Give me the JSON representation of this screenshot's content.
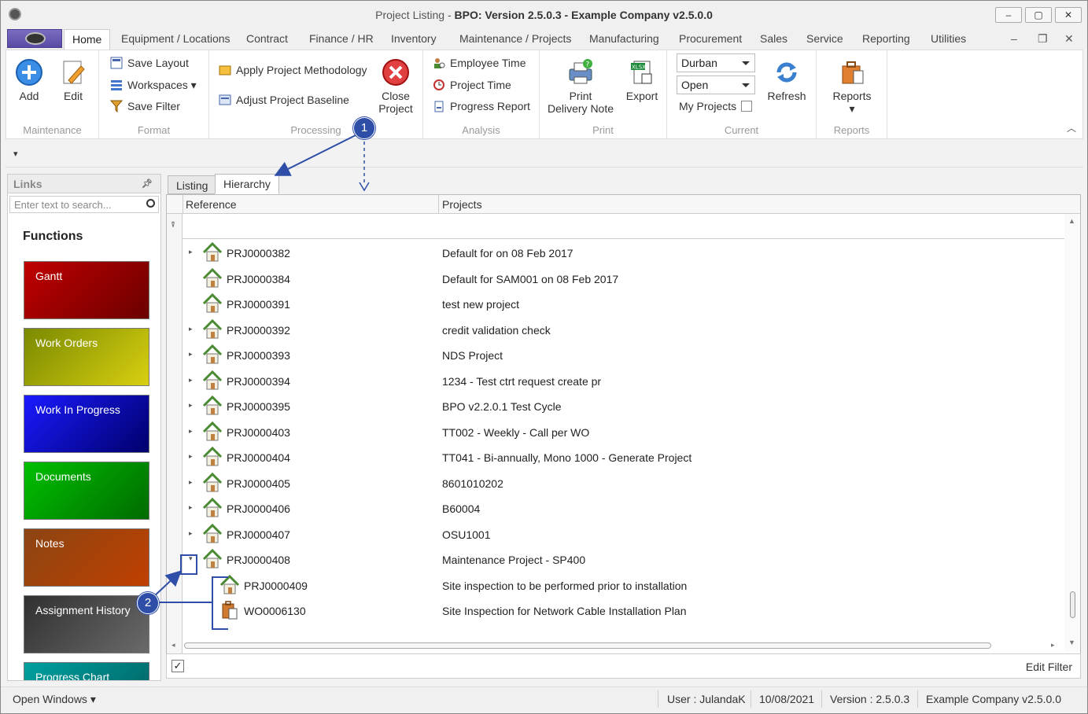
{
  "window": {
    "title_prefix": "Project Listing - ",
    "title_bold": "BPO: Version 2.5.0.3 - Example Company v2.5.0.0",
    "min_label": "–",
    "max_label": "▢",
    "close_label": "✕"
  },
  "menu": {
    "tabs": [
      "Home",
      "Equipment / Locations",
      "Contract",
      "Finance / HR",
      "Inventory",
      "Maintenance / Projects",
      "Manufacturing",
      "Procurement",
      "Sales",
      "Service",
      "Reporting",
      "Utilities"
    ],
    "mdi_min": "–",
    "mdi_restore": "❐",
    "mdi_close": "✕"
  },
  "ribbon": {
    "maintenance": {
      "label": "Maintenance",
      "add": "Add",
      "edit": "Edit"
    },
    "format": {
      "label": "Format",
      "save_layout": "Save Layout",
      "workspaces": "Workspaces",
      "save_filter": "Save Filter"
    },
    "processing": {
      "label": "Processing",
      "apply_methodology": "Apply Project Methodology",
      "adjust_baseline": "Adjust Project Baseline",
      "close_project_1": "Close",
      "close_project_2": "Project"
    },
    "analysis": {
      "label": "Analysis",
      "employee_time": "Employee Time",
      "project_time": "Project Time",
      "progress_report": "Progress Report"
    },
    "print": {
      "label": "Print",
      "print_dn_1": "Print",
      "print_dn_2": "Delivery Note",
      "export": "Export"
    },
    "current": {
      "label": "Current",
      "site": "Durban",
      "status": "Open",
      "my_projects": "My Projects",
      "refresh": "Refresh"
    },
    "reports": {
      "label": "Reports",
      "reports": "Reports"
    }
  },
  "links": {
    "title": "Links",
    "search_placeholder": "Enter text to search...",
    "functions_title": "Functions",
    "tiles": [
      {
        "label": "Gantt",
        "color_a": "#c00000",
        "color_b": "#6b0000"
      },
      {
        "label": "Work Orders",
        "color_a": "#7a8a00",
        "color_b": "#d8cf10"
      },
      {
        "label": "Work In Progress",
        "color_a": "#1a1aff",
        "color_b": "#00006b"
      },
      {
        "label": "Documents",
        "color_a": "#00c000",
        "color_b": "#006b00"
      },
      {
        "label": "Notes",
        "color_a": "#8b4513",
        "color_b": "#c04000"
      },
      {
        "label": "Assignment History",
        "color_a": "#303030",
        "color_b": "#6a6a6a"
      },
      {
        "label": "Progress Chart",
        "color_a": "#00a0a0",
        "color_b": "#006060"
      }
    ]
  },
  "tabs": {
    "listing": "Listing",
    "hierarchy": "Hierarchy"
  },
  "grid": {
    "columns": {
      "reference": "Reference",
      "projects": "Projects"
    },
    "rows": [
      {
        "ref": "PRJ0000382",
        "proj": "Default for  on 08 Feb 2017",
        "expander": "▸",
        "level": 0
      },
      {
        "ref": "PRJ0000384",
        "proj": "Default for SAM001 on 08 Feb 2017",
        "expander": "",
        "level": 0
      },
      {
        "ref": "PRJ0000391",
        "proj": "test new project",
        "expander": "",
        "level": 0
      },
      {
        "ref": "PRJ0000392",
        "proj": "credit validation check",
        "expander": "▸",
        "level": 0
      },
      {
        "ref": "PRJ0000393",
        "proj": "NDS Project",
        "expander": "▸",
        "level": 0
      },
      {
        "ref": "PRJ0000394",
        "proj": "1234 - Test ctrt request create pr",
        "expander": "▸",
        "level": 0
      },
      {
        "ref": "PRJ0000395",
        "proj": "BPO v2.2.0.1 Test Cycle",
        "expander": "▸",
        "level": 0
      },
      {
        "ref": "PRJ0000403",
        "proj": "TT002 - Weekly - Call per WO",
        "expander": "▸",
        "level": 0
      },
      {
        "ref": "PRJ0000404",
        "proj": "TT041 - Bi-annually, Mono 1000 - Generate Project",
        "expander": "▸",
        "level": 0
      },
      {
        "ref": "PRJ0000405",
        "proj": "8601010202",
        "expander": "▸",
        "level": 0
      },
      {
        "ref": "PRJ0000406",
        "proj": "B60004",
        "expander": "▸",
        "level": 0
      },
      {
        "ref": "PRJ0000407",
        "proj": "OSU1001",
        "expander": "▸",
        "level": 0
      },
      {
        "ref": "PRJ0000408",
        "proj": "Maintenance Project - SP400",
        "expander": "▾",
        "level": 0
      },
      {
        "ref": "PRJ0000409",
        "proj": "Site inspection to be performed prior to installation",
        "expander": "",
        "level": 1
      },
      {
        "ref": "WO0006130",
        "proj": "Site Inspection for Network Cable Installation Plan",
        "expander": "",
        "level": 1,
        "icon": "work-order"
      }
    ],
    "edit_filter": "Edit Filter",
    "filter_icon": "⍒"
  },
  "status": {
    "open_windows": "Open Windows",
    "user": "User : JulandaK",
    "date": "10/08/2021",
    "version": "Version : 2.5.0.3",
    "company": "Example Company v2.5.0.0"
  },
  "callouts": {
    "one": "1",
    "two": "2"
  }
}
